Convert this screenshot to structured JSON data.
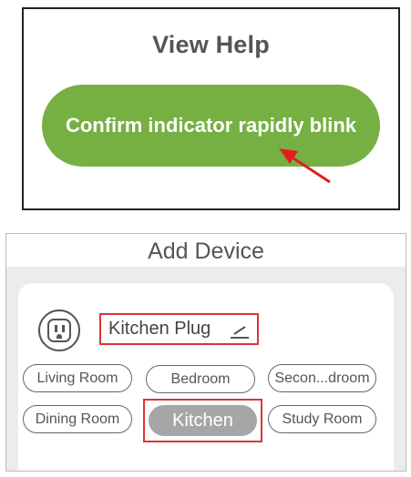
{
  "help": {
    "title": "View Help",
    "confirm_button": "Confirm indicator rapidly blink"
  },
  "device": {
    "header_title": "Add Device",
    "name": "Kitchen Plug",
    "rooms": [
      {
        "label": "Living Room",
        "selected": false
      },
      {
        "label": "Bedroom",
        "selected": false
      },
      {
        "label": "Secon...droom",
        "selected": false
      },
      {
        "label": "Dining Room",
        "selected": false
      },
      {
        "label": "Kitchen",
        "selected": true
      },
      {
        "label": "Study Room",
        "selected": false
      }
    ]
  },
  "colors": {
    "accent_green": "#76b043",
    "highlight_red": "#d33333",
    "selected_gray": "#a6a6a6"
  }
}
